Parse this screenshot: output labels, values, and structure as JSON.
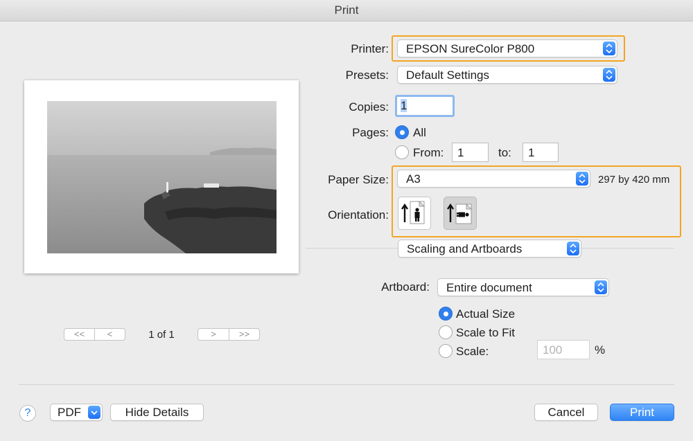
{
  "window": {
    "title": "Print"
  },
  "printer": {
    "label": "Printer:",
    "value": "EPSON SureColor P800"
  },
  "presets": {
    "label": "Presets:",
    "value": "Default Settings"
  },
  "copies": {
    "label": "Copies:",
    "value": "1"
  },
  "pages": {
    "label": "Pages:",
    "all_label": "All",
    "from_label": "From:",
    "from_value": "1",
    "to_label": "to:",
    "to_value": "1",
    "selected": "All"
  },
  "paper_size": {
    "label": "Paper Size:",
    "value": "A3",
    "dimensions": "297 by 420 mm"
  },
  "orientation": {
    "label": "Orientation:",
    "selected": "portrait"
  },
  "section_popup": {
    "value": "Scaling and Artboards"
  },
  "artboard": {
    "label": "Artboard:",
    "value": "Entire document"
  },
  "scaling": {
    "actual_size_label": "Actual Size",
    "scale_to_fit_label": "Scale to Fit",
    "scale_label": "Scale:",
    "scale_placeholder": "100",
    "percent": "%",
    "selected": "Actual Size"
  },
  "preview": {
    "page_indicator": "1 of 1",
    "first_label": "<<",
    "prev_label": "<",
    "next_label": ">",
    "last_label": ">>"
  },
  "footer": {
    "help_label": "?",
    "pdf_label": "PDF",
    "hide_details_label": "Hide Details",
    "cancel_label": "Cancel",
    "print_label": "Print"
  },
  "colors": {
    "accent": "#2f80ed",
    "highlight": "#f2a522",
    "primary_button": "#3b8cf5"
  }
}
